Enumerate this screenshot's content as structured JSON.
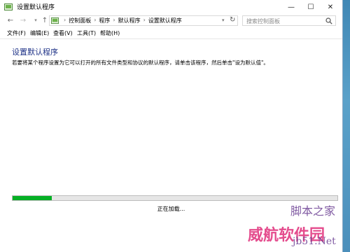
{
  "window": {
    "title": "设置默认程序",
    "controls": {
      "minimize": "—",
      "maximize": "☐",
      "close": "✕"
    }
  },
  "nav": {
    "breadcrumbs": [
      "控制面板",
      "程序",
      "默认程序",
      "设置默认程序"
    ],
    "search_placeholder": "搜索控制面板"
  },
  "menu": [
    "文件(F)",
    "编辑(E)",
    "查看(V)",
    "工具(T)",
    "帮助(H)"
  ],
  "content": {
    "heading": "设置默认程序",
    "description": "若要将某个程序设置为它可以打开的所有文件类型和协议的默认程序，请单击该程序，然后单击\"设为默认值\"。",
    "loading_text": "正在加载...",
    "progress": 0.12
  },
  "colors": {
    "heading": "#1e3287",
    "progress_fill": "#06b025"
  },
  "watermark": {
    "line1": "脚本之家",
    "line2": "威航软件园",
    "line3": "jb51.Net"
  }
}
